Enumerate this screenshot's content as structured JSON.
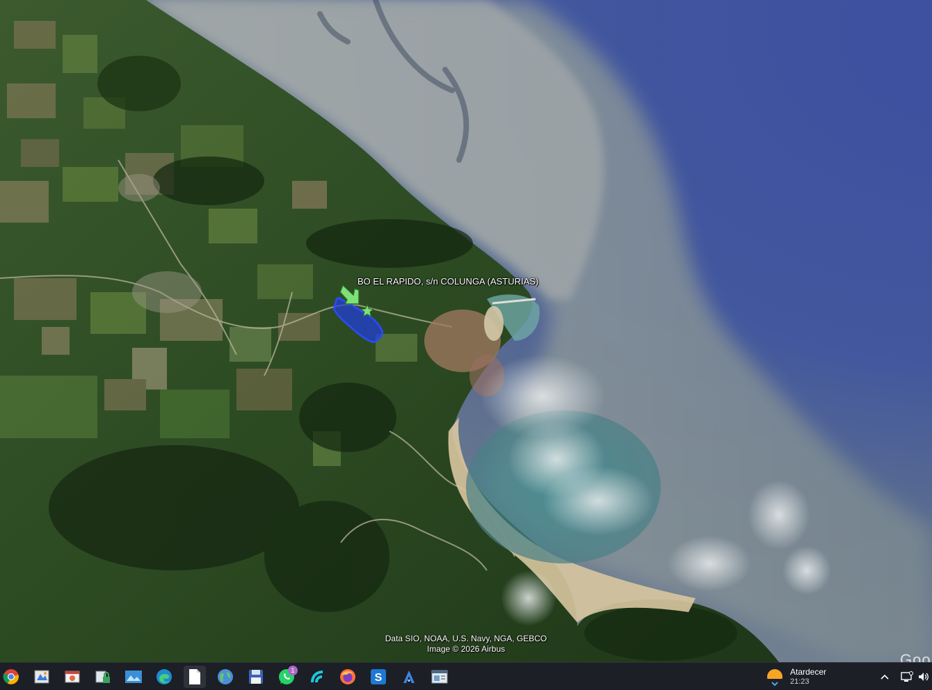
{
  "map": {
    "placemark_label": "BO EL RAPIDO, s/n COLUNGA (ASTURIAS)",
    "attribution_data": "Data SIO, NOAA, U.S. Navy, NGA, GEBCO",
    "attribution_image": "Image © 2026 Airbus",
    "corner_logo": "Goo",
    "polygon_color": "#1f3de0",
    "placemark_color": "#7fe07a"
  },
  "taskbar": {
    "apps": [
      {
        "name": "chrome-icon"
      },
      {
        "name": "paint-icon"
      },
      {
        "name": "photos-icon"
      },
      {
        "name": "vpn-icon"
      },
      {
        "name": "gallery-icon"
      },
      {
        "name": "edge-icon"
      },
      {
        "name": "document-icon"
      },
      {
        "name": "globe-icon"
      },
      {
        "name": "save-icon"
      },
      {
        "name": "whatsapp-icon",
        "badge": "1"
      },
      {
        "name": "wave-app-icon"
      },
      {
        "name": "firefox-icon"
      },
      {
        "name": "s-app-icon"
      },
      {
        "name": "a-app-icon"
      },
      {
        "name": "window-app-icon"
      }
    ],
    "whatsapp_badge": "1",
    "weather_label": "Atardecer",
    "clock_time": "21:23"
  }
}
